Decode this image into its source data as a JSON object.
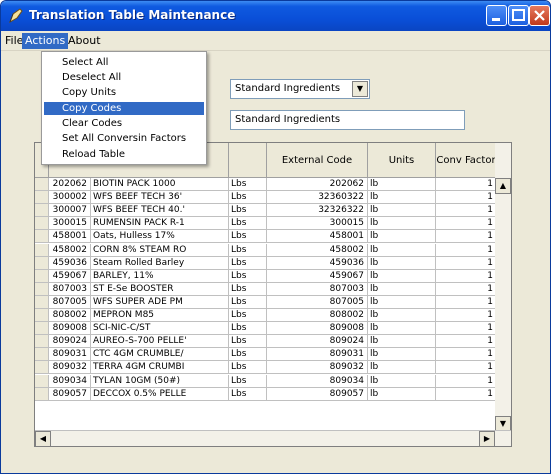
{
  "window": {
    "title": "Translation Table Maintenance"
  },
  "menubar": [
    "File",
    "Actions",
    "About"
  ],
  "actions_menu": {
    "items": [
      "Select All",
      "Deselect All",
      "Copy Units",
      "Copy Codes",
      "Clear Codes",
      "Set All Conversin Factors",
      "Reload Table"
    ],
    "highlighted": "Copy Codes"
  },
  "combo": {
    "value": "Standard Ingredients"
  },
  "description_field": {
    "value": "Standard Ingredients"
  },
  "grid": {
    "headers": [
      "",
      "",
      "",
      "External Code",
      "Units",
      "Conv Factor"
    ],
    "rows": [
      [
        "202062",
        "BIOTIN PACK 1000",
        "Lbs",
        "202062",
        "lb",
        "1"
      ],
      [
        "300002",
        "WFS BEEF TECH 36'",
        "Lbs",
        "32360322",
        "lb",
        "1"
      ],
      [
        "300007",
        "WFS BEEF TECH 40.'",
        "Lbs",
        "32326322",
        "lb",
        "1"
      ],
      [
        "300015",
        "RUMENSIN PACK R-1",
        "Lbs",
        "300015",
        "lb",
        "1"
      ],
      [
        "458001",
        "Oats, Hulless 17%",
        "Lbs",
        "458001",
        "lb",
        "1"
      ],
      [
        "458002",
        "CORN 8% STEAM RO",
        "Lbs",
        "458002",
        "lb",
        "1"
      ],
      [
        "459036",
        "Steam Rolled Barley",
        "Lbs",
        "459036",
        "lb",
        "1"
      ],
      [
        "459067",
        "BARLEY, 11%",
        "Lbs",
        "459067",
        "lb",
        "1"
      ],
      [
        "807003",
        "ST E-Se BOOSTER",
        "Lbs",
        "807003",
        "lb",
        "1"
      ],
      [
        "807005",
        "WFS SUPER ADE PM",
        "Lbs",
        "807005",
        "lb",
        "1"
      ],
      [
        "808002",
        "MEPRON M85",
        "Lbs",
        "808002",
        "lb",
        "1"
      ],
      [
        "809008",
        "SCI-NIC-C/ST",
        "Lbs",
        "809008",
        "lb",
        "1"
      ],
      [
        "809024",
        "AUREO-S-700 PELLE'",
        "Lbs",
        "809024",
        "lb",
        "1"
      ],
      [
        "809031",
        "CTC 4GM CRUMBLE/",
        "Lbs",
        "809031",
        "lb",
        "1"
      ],
      [
        "809032",
        "TERRA 4GM CRUMBI",
        "Lbs",
        "809032",
        "lb",
        "1"
      ],
      [
        "809034",
        "TYLAN 10GM (50#)",
        "Lbs",
        "809034",
        "lb",
        "1"
      ],
      [
        "809057",
        "DECCOX 0.5% PELLE",
        "Lbs",
        "809057",
        "lb",
        "1"
      ]
    ]
  }
}
